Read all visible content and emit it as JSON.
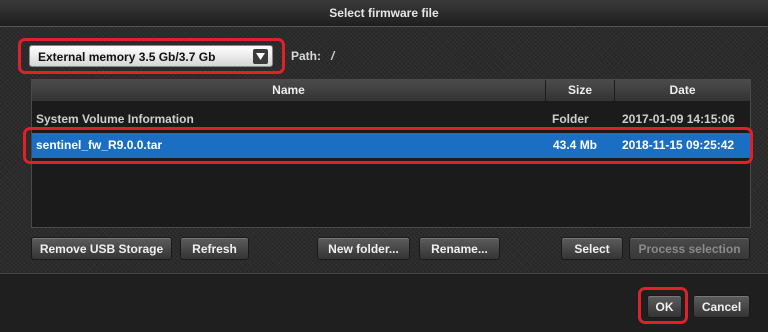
{
  "dialog": {
    "title": "Select firmware file"
  },
  "storage": {
    "selected": "External memory 3.5 Gb/3.7 Gb"
  },
  "path": {
    "label": "Path:",
    "value": "/"
  },
  "table": {
    "columns": [
      "Name",
      "Size",
      "Date"
    ],
    "rows": [
      {
        "name": "System Volume Information",
        "size": "Folder",
        "date": "2017-01-09 14:15:06",
        "selected": false
      },
      {
        "name": "sentinel_fw_R9.0.0.tar",
        "size": "43.4 Mb",
        "date": "2018-11-15 09:25:42",
        "selected": true
      }
    ]
  },
  "toolbar": {
    "remove_usb": "Remove USB Storage",
    "refresh": "Refresh",
    "new_folder": "New folder...",
    "rename": "Rename...",
    "select": "Select",
    "process_selection": "Process selection"
  },
  "footer": {
    "ok": "OK",
    "cancel": "Cancel"
  },
  "colors": {
    "highlight": "#e0202a",
    "selection": "#1a6fc3"
  },
  "icons": {
    "dropdown": "dropdown-arrow-icon"
  }
}
